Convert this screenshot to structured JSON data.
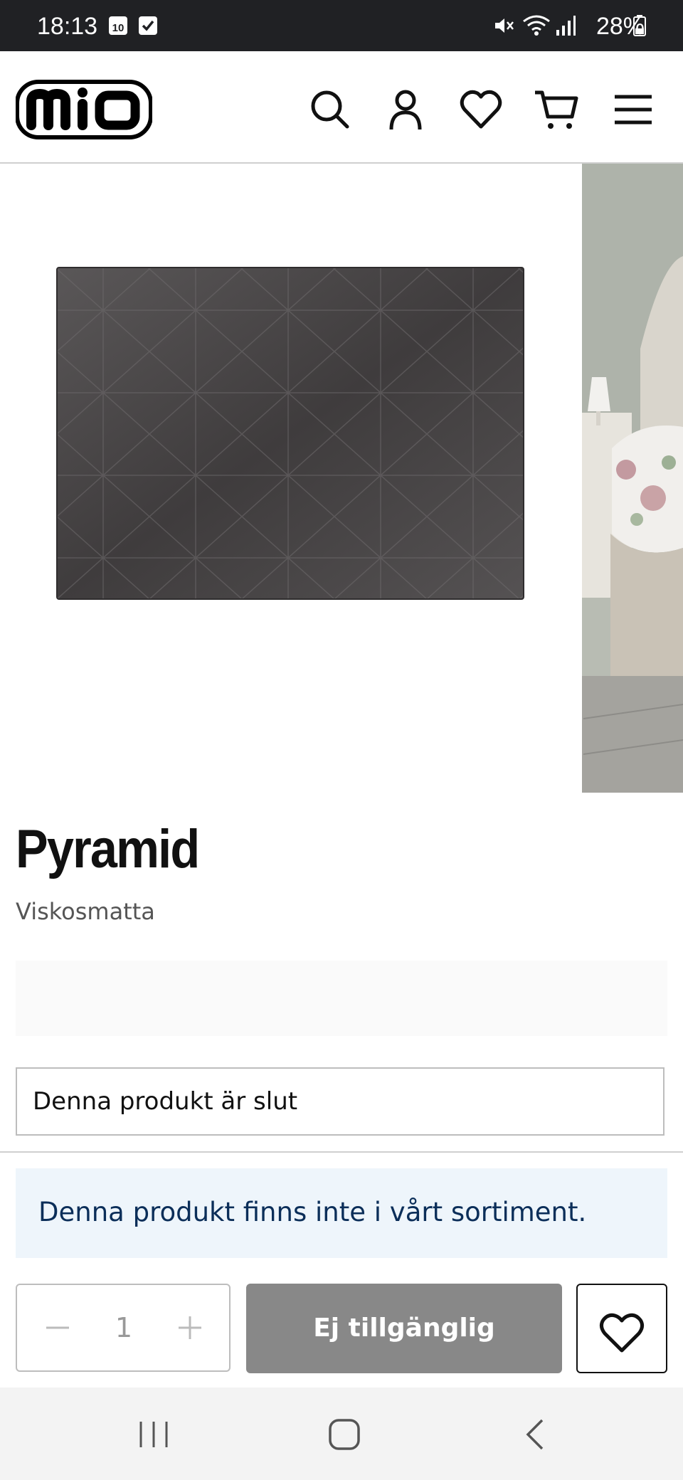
{
  "status_bar": {
    "time": "18:13",
    "calendar_day": "10",
    "battery": "28%"
  },
  "header": {
    "logo_text": "mio"
  },
  "product": {
    "title": "Pyramid",
    "subtitle": "Viskosmatta",
    "stock_status": "Denna produkt är slut",
    "notice": "Denna produkt finns inte i vårt sortiment.",
    "quantity": "1",
    "buy_button_label": "Ej tillgänglig"
  },
  "colors": {
    "notice_bg": "#eef5fb",
    "notice_text": "#0b2e59",
    "disabled_button": "#888888",
    "rug": "#4a4748"
  }
}
